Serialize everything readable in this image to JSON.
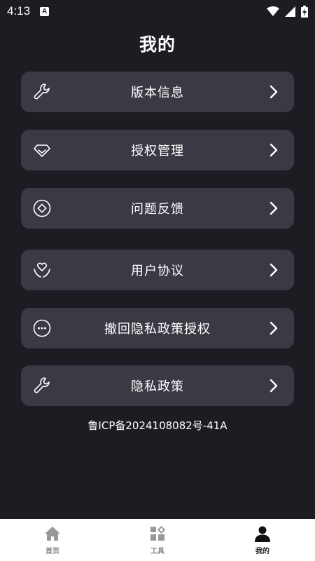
{
  "status_bar": {
    "time": "4:13",
    "notification_letter": "A"
  },
  "page": {
    "title": "我的"
  },
  "menu": {
    "items": [
      {
        "label": "版本信息",
        "icon": "wrench-icon"
      },
      {
        "label": "授权管理",
        "icon": "diamond-icon"
      },
      {
        "label": "问题反馈",
        "icon": "feedback-icon"
      },
      {
        "label": "用户协议",
        "icon": "heart-hands-icon"
      },
      {
        "label": "撤回隐私政策授权",
        "icon": "dots-icon"
      },
      {
        "label": "隐私政策",
        "icon": "wrench-icon"
      }
    ]
  },
  "footer": {
    "icp": "鲁ICP备2024108082号-41A"
  },
  "tabbar": {
    "tabs": [
      {
        "label": "首页",
        "icon": "home-icon",
        "active": false
      },
      {
        "label": "工具",
        "icon": "tools-icon",
        "active": false
      },
      {
        "label": "我的",
        "icon": "user-icon",
        "active": true
      }
    ]
  },
  "colors": {
    "background": "#1c1c23",
    "card": "#3a3a44",
    "tabbar": "#ffffff"
  }
}
